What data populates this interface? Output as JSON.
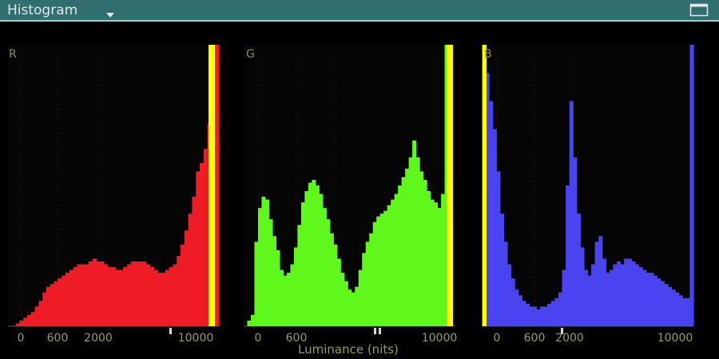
{
  "header": {
    "title": "Histogram",
    "dropdown_icon": "caret-down-icon",
    "maximize_icon": "maximize-window-icon"
  },
  "x_axis": {
    "title": "Luminance (nits)"
  },
  "colors": {
    "titlebar": "#2f6f6f",
    "axis_text": "#9a9a52",
    "channel_label": "#8c8c46",
    "red": "#ee1c24",
    "green": "#5ef81c",
    "blue": "#4a43f0",
    "clip_marker": "#ffff00",
    "grid": "#2e2e2e"
  },
  "chart_data": [
    {
      "type": "area",
      "channel": "R",
      "x_scale": "pq-luminance",
      "tick_labels": [
        "0",
        "600",
        "2000",
        "10000"
      ],
      "grid": true,
      "series": [
        {
          "values": [
            0,
            0,
            1,
            2,
            3,
            4,
            5,
            7,
            9,
            12,
            14,
            15,
            16,
            17,
            18,
            19,
            20,
            21,
            22,
            22,
            22,
            23,
            24,
            23,
            23,
            22,
            21,
            21,
            20,
            20,
            21,
            22,
            23,
            23,
            23,
            23,
            22,
            21,
            20,
            19,
            19,
            20,
            21,
            22,
            25,
            29,
            34,
            40,
            46,
            55,
            58,
            63,
            72,
            100,
            100
          ]
        }
      ],
      "ylim": [
        0,
        100
      ]
    },
    {
      "type": "area",
      "channel": "G",
      "x_scale": "pq-luminance",
      "tick_labels": [
        "0",
        "600",
        "10000"
      ],
      "grid": true,
      "series": [
        {
          "values": [
            0,
            2,
            4,
            30,
            42,
            46,
            45,
            38,
            32,
            27,
            20,
            18,
            19,
            22,
            28,
            36,
            44,
            48,
            51,
            52,
            50,
            47,
            42,
            38,
            33,
            29,
            24,
            19,
            16,
            13,
            12,
            14,
            20,
            26,
            30,
            33,
            37,
            39,
            40,
            41,
            43,
            45,
            47,
            50,
            53,
            56,
            60,
            66,
            60,
            55,
            52,
            48,
            45,
            44,
            42,
            47,
            100,
            100,
            0
          ]
        }
      ],
      "ylim": [
        0,
        100
      ]
    },
    {
      "type": "area",
      "channel": "B",
      "x_scale": "pq-luminance",
      "tick_labels": [
        "0",
        "600",
        "2000",
        "10000"
      ],
      "grid": true,
      "series": [
        {
          "values": [
            100,
            90,
            80,
            70,
            55,
            40,
            30,
            22,
            17,
            13,
            11,
            9,
            8,
            7,
            7,
            6,
            7,
            7,
            8,
            9,
            10,
            12,
            20,
            50,
            80,
            60,
            40,
            28,
            20,
            18,
            22,
            30,
            32,
            24,
            19,
            20,
            22,
            23,
            22,
            24,
            24,
            23,
            22,
            21,
            20,
            19,
            19,
            18,
            17,
            16,
            15,
            14,
            13,
            12,
            11,
            10,
            10,
            100
          ]
        }
      ],
      "ylim": [
        0,
        100
      ]
    }
  ]
}
